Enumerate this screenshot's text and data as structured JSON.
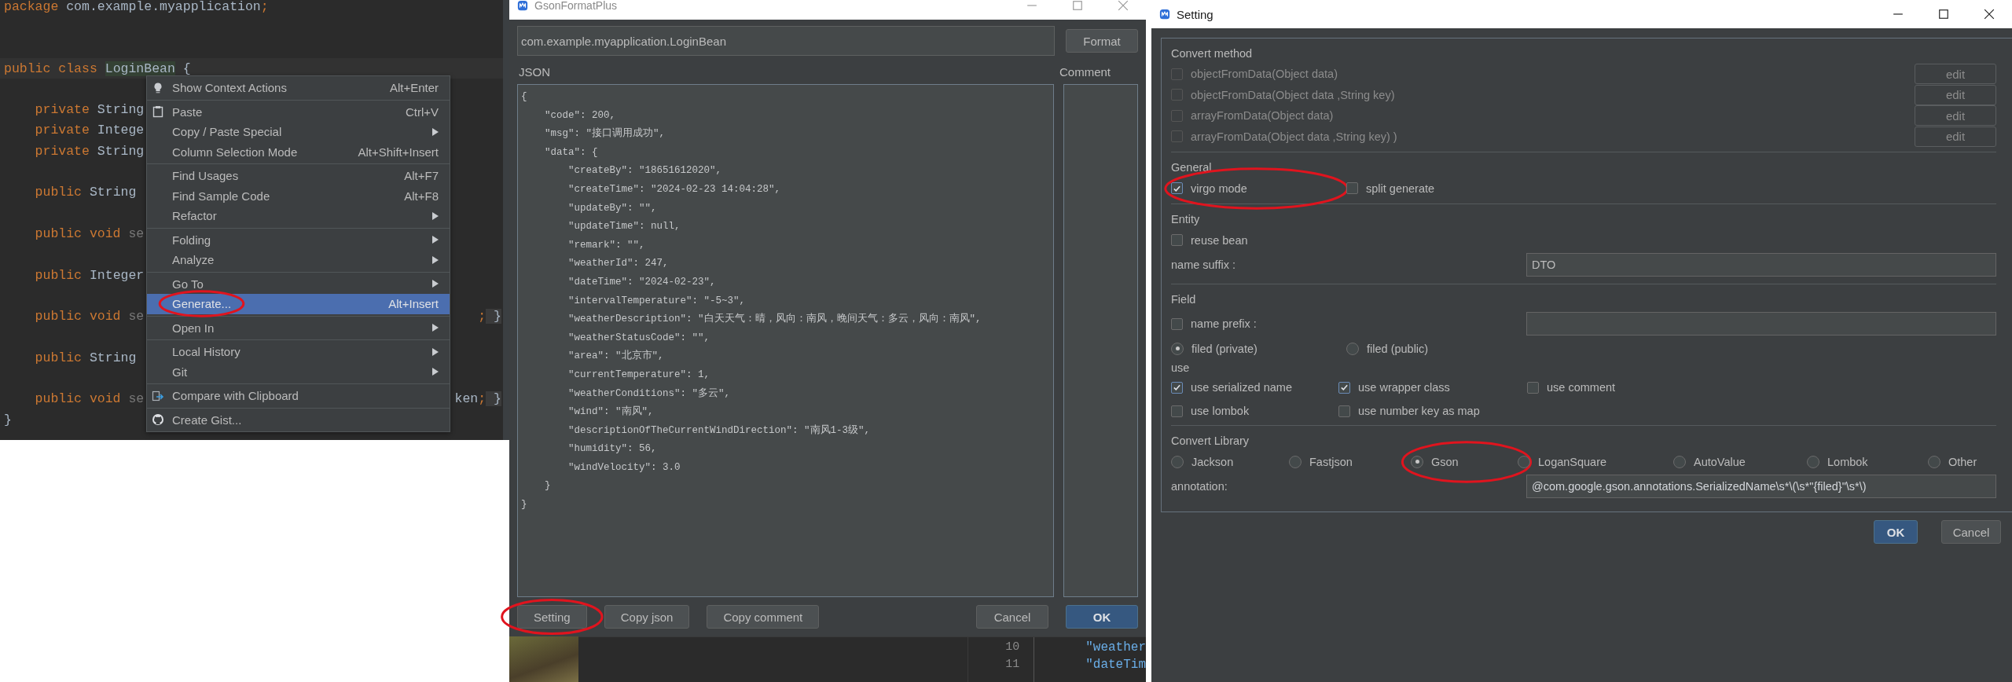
{
  "editor": {
    "lines": [
      {
        "kind": "code",
        "segments": [
          {
            "kind": "keyword",
            "text": "package"
          },
          {
            "kind": "plain",
            "text": " com.example.myapplication"
          },
          {
            "kind": "keyword",
            "text": ";"
          }
        ]
      },
      {
        "kind": "blank"
      },
      {
        "kind": "blank"
      },
      {
        "kind": "current",
        "segments": [
          {
            "kind": "keyword",
            "text": "public class "
          },
          {
            "kind": "match",
            "text": "LoginBean"
          },
          {
            "kind": "plain",
            "text": " {"
          }
        ]
      },
      {
        "kind": "blank"
      },
      {
        "kind": "code",
        "segments": [
          {
            "kind": "keyword",
            "text": "    private "
          },
          {
            "kind": "plain",
            "text": "String"
          }
        ]
      },
      {
        "kind": "code",
        "segments": [
          {
            "kind": "keyword",
            "text": "    private "
          },
          {
            "kind": "plain",
            "text": "Intege"
          }
        ]
      },
      {
        "kind": "code",
        "segments": [
          {
            "kind": "keyword",
            "text": "    private "
          },
          {
            "kind": "plain",
            "text": "String"
          }
        ]
      },
      {
        "kind": "blank"
      },
      {
        "kind": "code",
        "segments": [
          {
            "kind": "keyword",
            "text": "    public "
          },
          {
            "kind": "plain",
            "text": "String"
          }
        ]
      },
      {
        "kind": "blank"
      },
      {
        "kind": "code",
        "segments": [
          {
            "kind": "keyword",
            "text": "    public void "
          },
          {
            "kind": "muted",
            "text": "se"
          }
        ]
      },
      {
        "kind": "blank"
      },
      {
        "kind": "code",
        "segments": [
          {
            "kind": "keyword",
            "text": "    public "
          },
          {
            "kind": "plain",
            "text": "Integer"
          }
        ]
      },
      {
        "kind": "blank"
      },
      {
        "kind": "code",
        "segments": [
          {
            "kind": "keyword",
            "text": "    public void "
          },
          {
            "kind": "muted",
            "text": "se"
          }
        ],
        "tail": [
          {
            "kind": "keyword",
            "text": ";"
          },
          {
            "kind": "brace",
            "text": " }"
          }
        ]
      },
      {
        "kind": "blank"
      },
      {
        "kind": "code",
        "segments": [
          {
            "kind": "keyword",
            "text": "    public "
          },
          {
            "kind": "plain",
            "text": "String"
          }
        ]
      },
      {
        "kind": "blank"
      },
      {
        "kind": "code",
        "segments": [
          {
            "kind": "keyword",
            "text": "    public void "
          },
          {
            "kind": "muted",
            "text": "se"
          }
        ],
        "tail": [
          {
            "kind": "plain",
            "text": "ken"
          },
          {
            "kind": "keyword",
            "text": ";"
          },
          {
            "kind": "brace",
            "text": " }"
          }
        ]
      },
      {
        "kind": "code",
        "segments": [
          {
            "kind": "plain",
            "text": "}"
          }
        ]
      }
    ]
  },
  "context_menu": {
    "groups": [
      {
        "items": [
          {
            "label": "Show Context Actions",
            "shortcut": "Alt+Enter",
            "submenu": false,
            "selected": false,
            "circled": false
          }
        ]
      },
      {
        "items": [
          {
            "label": "Paste",
            "shortcut": "Ctrl+V",
            "submenu": false,
            "selected": false,
            "circled": false
          },
          {
            "label": "Copy / Paste Special",
            "submenu": true,
            "selected": false,
            "circled": false
          },
          {
            "label": "Column Selection Mode",
            "shortcut": "Alt+Shift+Insert",
            "submenu": false,
            "selected": false,
            "circled": false
          }
        ]
      },
      {
        "items": [
          {
            "label": "Find Usages",
            "shortcut": "Alt+F7",
            "submenu": false,
            "selected": false,
            "circled": false
          },
          {
            "label": "Find Sample Code",
            "shortcut": "Alt+F8",
            "submenu": false,
            "selected": false,
            "circled": false
          },
          {
            "label": "Refactor",
            "submenu": true,
            "selected": false,
            "circled": false
          }
        ]
      },
      {
        "items": [
          {
            "label": "Folding",
            "submenu": true,
            "selected": false,
            "circled": false
          },
          {
            "label": "Analyze",
            "submenu": true,
            "selected": false,
            "circled": false
          }
        ]
      },
      {
        "items": [
          {
            "label": "Go To",
            "submenu": true,
            "selected": false,
            "circled": false
          },
          {
            "label": "Generate...",
            "shortcut": "Alt+Insert",
            "submenu": false,
            "selected": true,
            "circled": true
          }
        ]
      },
      {
        "items": [
          {
            "label": "Open In",
            "submenu": true,
            "selected": false,
            "circled": false
          }
        ]
      },
      {
        "items": [
          {
            "label": "Local History",
            "submenu": true,
            "selected": false,
            "circled": false
          },
          {
            "label": "Git",
            "submenu": true,
            "selected": false,
            "circled": false
          }
        ]
      },
      {
        "items": [
          {
            "label": "Compare with Clipboard",
            "submenu": false,
            "selected": false,
            "circled": false
          }
        ]
      },
      {
        "items": [
          {
            "label": "Create Gist...",
            "submenu": false,
            "selected": false,
            "circled": false
          }
        ]
      }
    ]
  },
  "gson_dialog": {
    "title": "GsonFormatPlus",
    "class_field": {
      "value": "com.example.myapplication.LoginBean"
    },
    "format_button": "Format",
    "json_label": "JSON",
    "comment_label": "Comment",
    "json_text": "{\n    \"code\": 200,\n    \"msg\": \"接口调用成功\",\n    \"data\": {\n        \"createBy\": \"18651612020\",\n        \"createTime\": \"2024-02-23 14:04:28\",\n        \"updateBy\": \"\",\n        \"updateTime\": null,\n        \"remark\": \"\",\n        \"weatherId\": 247,\n        \"dateTime\": \"2024-02-23\",\n        \"intervalTemperature\": \"-5~3\",\n        \"weatherDescription\": \"白天天气：晴，风向：南风，晚间天气：多云，风向：南风\",\n        \"weatherStatusCode\": \"\",\n        \"area\": \"北京市\",\n        \"currentTemperature\": 1,\n        \"weatherConditions\": \"多云\",\n        \"wind\": \"南风\",\n        \"descriptionOfTheCurrentWindDirection\": \"南风1-3级\",\n        \"humidity\": 56,\n        \"windVelocity\": 3.0\n    }\n}",
    "left_buttons": [
      {
        "label": "Setting",
        "circled": true
      },
      {
        "label": "Copy  json",
        "circled": false
      },
      {
        "label": "Copy comment",
        "circled": false
      }
    ],
    "right_buttons": [
      {
        "label": "Cancel",
        "primary": false
      },
      {
        "label": "OK",
        "primary": true
      }
    ]
  },
  "background_editor": {
    "lines": [
      {
        "number": "10",
        "text": "\"weather"
      },
      {
        "number": "11",
        "text": "\"dateTim"
      }
    ]
  },
  "setting_dialog": {
    "title": "Setting",
    "convert_method": {
      "title": "Convert method",
      "options": [
        {
          "label": "objectFromData(Object data)",
          "checked": false,
          "disabled": true,
          "button": "edit"
        },
        {
          "label": "objectFromData(Object data ,String key)",
          "checked": false,
          "disabled": true,
          "button": "edit"
        },
        {
          "label": "arrayFromData(Object data)",
          "checked": false,
          "disabled": true,
          "button": "edit"
        },
        {
          "label": "arrayFromData(Object data ,String key) )",
          "checked": false,
          "disabled": true,
          "button": "edit"
        }
      ]
    },
    "general": {
      "title": "General",
      "options": [
        {
          "label": "virgo mode",
          "checked": true,
          "circled": true
        },
        {
          "label": "split generate",
          "checked": false,
          "circled": false
        }
      ]
    },
    "entity": {
      "title": "Entity",
      "reuse_bean": {
        "label": "reuse bean",
        "checked": false
      },
      "name_suffix": {
        "label": "name suffix :",
        "value": "DTO"
      }
    },
    "field": {
      "title": "Field",
      "name_prefix": {
        "label": "name prefix :",
        "checked": false
      },
      "visibility": [
        {
          "label": "filed (private)",
          "selected": true
        },
        {
          "label": "filed (public)",
          "selected": false
        }
      ],
      "use_label": "use",
      "use_options": [
        {
          "label": "use serialized name",
          "checked": true
        },
        {
          "label": "use wrapper class",
          "checked": true
        },
        {
          "label": "use comment",
          "checked": false
        },
        {
          "label": "use lombok",
          "checked": false
        },
        {
          "label": "use number key as map",
          "checked": false
        }
      ]
    },
    "convert_library": {
      "title": "Convert Library",
      "libraries": [
        {
          "label": "Jackson",
          "selected": false,
          "circled": false
        },
        {
          "label": "Fastjson",
          "selected": false,
          "circled": false
        },
        {
          "label": "Gson",
          "selected": true,
          "circled": true
        },
        {
          "label": "LoganSquare",
          "selected": false,
          "circled": false
        },
        {
          "label": "AutoValue",
          "selected": false,
          "circled": false
        },
        {
          "label": "Lombok",
          "selected": false,
          "circled": false
        },
        {
          "label": "Other",
          "selected": false,
          "circled": false
        }
      ],
      "annotation": {
        "label": "annotation:",
        "value": "@com.google.gson.annotations.SerializedName\\s*\\(\\s*\"{filed}\"\\s*\\)"
      }
    },
    "buttons": [
      {
        "label": "OK",
        "primary": true
      },
      {
        "label": "Cancel",
        "primary": false
      }
    ]
  }
}
